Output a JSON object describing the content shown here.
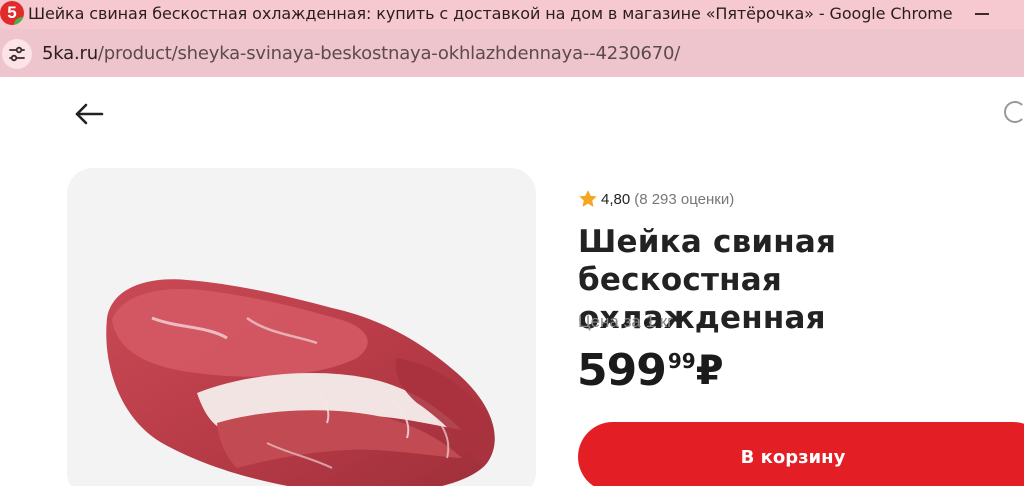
{
  "browser": {
    "window_title": "Шейка свиная бескостная охлажденная: купить с доставкой на дом в магазине «Пятёрочка» - Google Chrome",
    "favicon_text": "5",
    "url_domain": "5ka.ru",
    "url_path": "/product/sheyka-svinaya-beskostnaya-okhlazhdennaya--4230670/"
  },
  "colors": {
    "brand_red": "#e31e24",
    "titlebar": "#f6c8cf",
    "star": "#f5a623"
  },
  "product": {
    "rating_value": "4,80",
    "rating_count": "(8 293 оценки)",
    "title": "Шейка свиная бескостная охлажденная",
    "unit_label": "Цена за 1 кг",
    "price_integer": "599",
    "price_fraction": "99",
    "currency": "₽",
    "cart_button_label": "В корзину"
  },
  "icons": {
    "back": "arrow-left-icon",
    "rating": "star-icon",
    "site_info": "tune-icon"
  }
}
